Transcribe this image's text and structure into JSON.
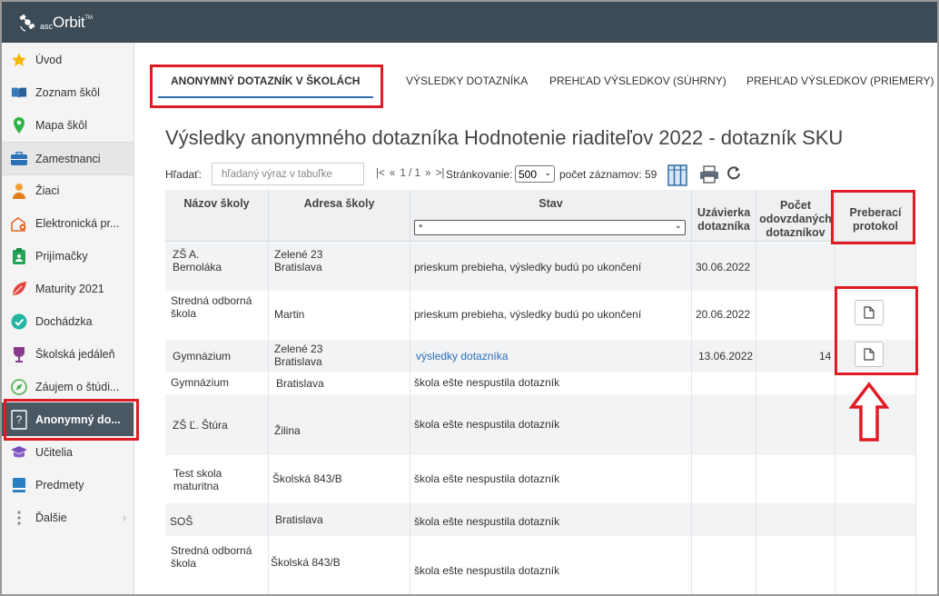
{
  "brand": {
    "asc": "asc",
    "orbit": "Orbit",
    "tm": "TM"
  },
  "sidebar": {
    "items": [
      {
        "label": "Úvod",
        "icon": "star-icon"
      },
      {
        "label": "Zoznam škôl",
        "icon": "book-icon"
      },
      {
        "label": "Mapa škôl",
        "icon": "map-pin-icon"
      },
      {
        "label": "Zamestnanci",
        "icon": "briefcase-icon"
      },
      {
        "label": "Žiaci",
        "icon": "student-icon"
      },
      {
        "label": "Elektronická pr...",
        "icon": "school-gear-icon"
      },
      {
        "label": "Prijímačky",
        "icon": "clipboard-icon"
      },
      {
        "label": "Maturity 2021",
        "icon": "leaf-icon"
      },
      {
        "label": "Dochádzka",
        "icon": "check-circle-icon"
      },
      {
        "label": "Školská jedáleň",
        "icon": "cup-icon"
      },
      {
        "label": "Záujem o štúdi...",
        "icon": "compass-icon"
      },
      {
        "label": "Anonymný do...",
        "icon": "question-icon"
      },
      {
        "label": "Učitelia",
        "icon": "graduation-cap-icon"
      },
      {
        "label": "Predmety",
        "icon": "notebook-icon"
      },
      {
        "label": "Ďalšie",
        "icon": "more-vertical-icon"
      }
    ]
  },
  "tabs": [
    {
      "label": "ANONYMNÝ DOTAZNÍK V ŠKOLÁCH"
    },
    {
      "label": "VÝSLEDKY DOTAZNÍKA"
    },
    {
      "label": "PREHĽAD VÝSLEDKOV (SÚHRNY)"
    },
    {
      "label": "PREHĽAD VÝSLEDKOV (PRIEMERY)"
    }
  ],
  "page_title": "Výsledky anonymného dotazníka Hodnotenie riaditeľov 2022 - dotazník SKU",
  "toolbar": {
    "search_label": "Hľadať:",
    "search_placeholder": "hľadaný výraz v tabuľke",
    "pager_first": "|<",
    "pager_prev": "«",
    "pager_pages": "1 / 1",
    "pager_next": "»",
    "pager_last": ">|",
    "paging_label": "Stránkovanie:",
    "paging_value": "500",
    "count_label": "počet záznamov:",
    "count_value": "59"
  },
  "table": {
    "headers": {
      "school": "Názov školy",
      "address": "Adresa školy",
      "status": "Stav",
      "deadline_1": "Uzávierka",
      "deadline_2": "dotazníka",
      "count_1": "Počet",
      "count_2": "odovzdaných",
      "count_3": "dotazníkov",
      "protocol_1": "Preberací",
      "protocol_2": "protokol"
    },
    "status_filter": "*",
    "rows": [
      {
        "school_1": "ZŠ A.",
        "school_2": "Bernoláka",
        "address_1": "Zelené 23",
        "address_2": "Bratislava",
        "status": "prieskum prebieha, výsledky budú po ukončení",
        "deadline": "30.06.2022",
        "count": ""
      },
      {
        "school_1": "Stredná odborná",
        "school_2": "škola",
        "address_1": "Martin",
        "address_2": "",
        "status": "prieskum prebieha, výsledky budú po ukončení",
        "deadline": "20.06.2022",
        "count": ""
      },
      {
        "school_1": "Gymnázium",
        "school_2": "",
        "address_1": "Zelené 23",
        "address_2": "Bratislava",
        "status": "výsledky dotazníka",
        "deadline": "13.06.2022",
        "count": "14"
      },
      {
        "school_1": "Gymnázium",
        "school_2": "",
        "address_1": "Bratislava",
        "address_2": "",
        "status": "škola ešte nespustila dotazník",
        "deadline": "",
        "count": ""
      },
      {
        "school_1": "ZŠ Ľ. Štúra",
        "school_2": "",
        "address_1": "Žilina",
        "address_2": "",
        "status": "škola ešte nespustila dotazník",
        "deadline": "",
        "count": ""
      },
      {
        "school_1": "Test skola",
        "school_2": "maturitna",
        "address_1": "Školská 843/B",
        "address_2": "",
        "status": "škola ešte nespustila dotazník",
        "deadline": "",
        "count": ""
      },
      {
        "school_1": "SOŠ",
        "school_2": "",
        "address_1": "Bratislava",
        "address_2": "",
        "status": "škola ešte nespustila dotazník",
        "deadline": "",
        "count": ""
      },
      {
        "school_1": "Stredná odborná",
        "school_2": "škola",
        "address_1": "Školská 843/B",
        "address_2": "",
        "status": "škola ešte nespustila dotazník",
        "deadline": "",
        "count": ""
      }
    ]
  },
  "colors": {
    "topbar": "#3d4b56",
    "active_sidebar": "#4a5864",
    "highlight_red": "#e01b24",
    "link": "#2a6ebb"
  }
}
